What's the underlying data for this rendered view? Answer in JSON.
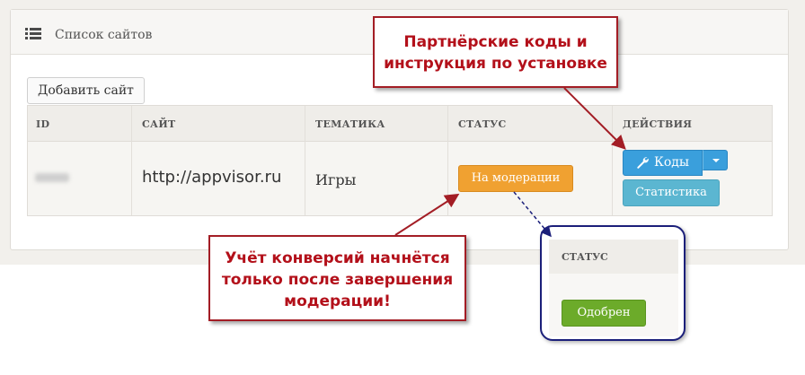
{
  "panel": {
    "title": "Список сайтов",
    "icon": "list-icon"
  },
  "toolbar": {
    "add_site_label": "Добавить сайт"
  },
  "table": {
    "columns": [
      "ID",
      "САЙТ",
      "ТЕМАТИКА",
      "СТАТУС",
      "ДЕЙСТВИЯ"
    ],
    "rows": [
      {
        "site": "http://appvisor.ru",
        "theme": "Игры",
        "status": "На модерации",
        "actions": {
          "codes": "Коды",
          "stats": "Статистика"
        }
      }
    ]
  },
  "callouts": {
    "codes": "Партнёрские коды и инструкция по установке",
    "conversion": "Учёт конверсий начнётся только после завершения модерации!"
  },
  "inset": {
    "header": "СТАТУС",
    "status": "Одобрен"
  },
  "colors": {
    "moderation": "#f0a131",
    "codes_button": "#3a9fdc",
    "stats_button": "#5bb6d1",
    "approved": "#6cab2a",
    "callout_text": "#b3101a",
    "callout_border": "#a31d25",
    "inset_border": "#1b1f7a"
  }
}
